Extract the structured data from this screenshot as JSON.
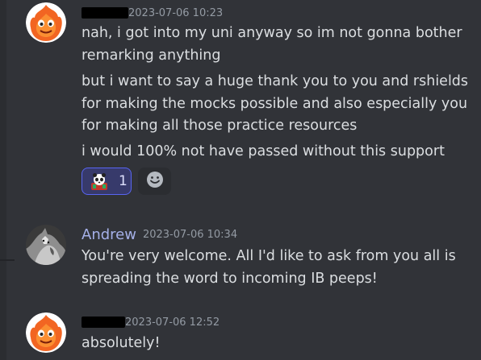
{
  "messages": [
    {
      "author": "",
      "timestamp": "2023-07-06 10:23",
      "avatar_icon": "calcifer-fire-avatar",
      "lines": [
        "nah, i got into my uni anyway so im not gonna bother",
        "remarking anything",
        "but i want to say a huge thank you to you and rshields",
        "for making the mocks possible and also especially you",
        "for making all those practice resources",
        "i would 100% not have passed without this support"
      ],
      "reactions": [
        {
          "emoji": "panda-emoji",
          "count": "1"
        }
      ],
      "add_reaction_icon": "smiley-face-icon"
    },
    {
      "author": "Andrew",
      "timestamp": "2023-07-06 10:34",
      "avatar_icon": "wolf-avatar",
      "lines": [
        "You're very welcome. All I'd like to ask from you all is",
        "spreading the word to incoming IB peeps!"
      ]
    },
    {
      "author": "",
      "timestamp": "2023-07-06 12:52",
      "avatar_icon": "calcifer-fire-avatar",
      "lines": [
        "absolutely!"
      ]
    }
  ],
  "colors": {
    "background": "#313338",
    "username_accent": "#a5b0e8",
    "timestamp": "#949ba4",
    "reaction_border": "#5865f2",
    "reaction_bg": "#373a6b"
  }
}
